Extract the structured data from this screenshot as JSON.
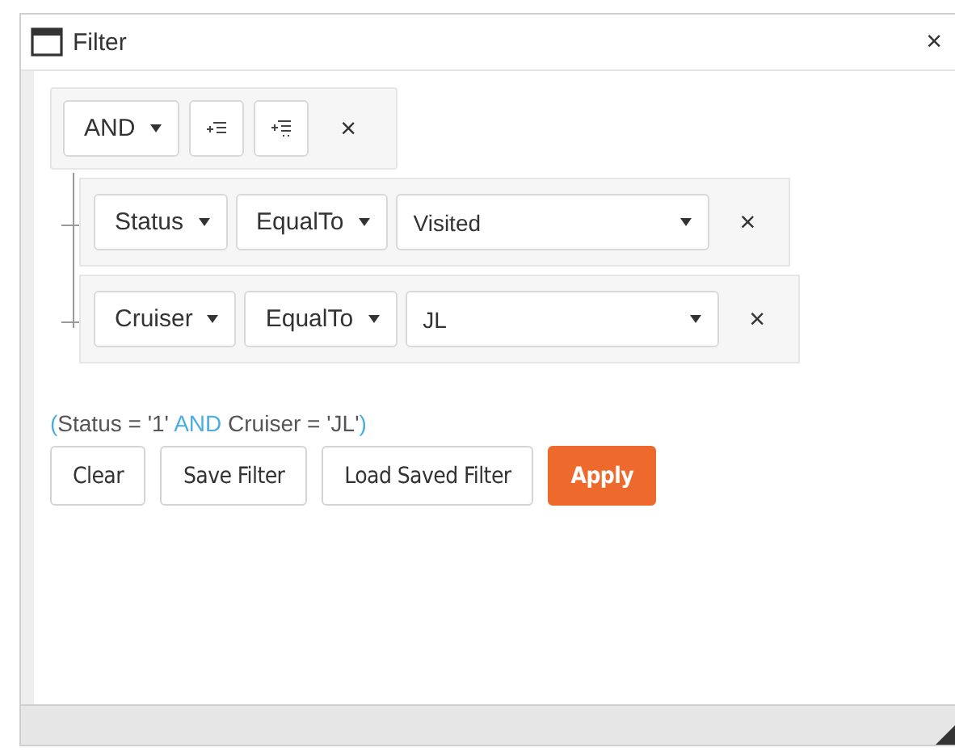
{
  "window": {
    "title": "Filter",
    "close": "×"
  },
  "group": {
    "operator": "AND",
    "remove": "×"
  },
  "rules": [
    {
      "field": "Status",
      "condition": "EqualTo",
      "value": "Visited",
      "remove": "×"
    },
    {
      "field": "Cruiser",
      "condition": "EqualTo",
      "value": "JL",
      "remove": "×"
    }
  ],
  "expression": [
    {
      "kind": "paren",
      "text": "("
    },
    {
      "kind": "text",
      "text": "Status = '1'"
    },
    {
      "kind": "operator",
      "text": "AND"
    },
    {
      "kind": "text",
      "text": "Cruiser = 'JL'"
    },
    {
      "kind": "paren",
      "text": ")"
    }
  ],
  "buttons": [
    {
      "label": "Clear",
      "kind": "default"
    },
    {
      "label": "Save Filter",
      "kind": "default"
    },
    {
      "label": "Load Saved Filter",
      "kind": "default"
    },
    {
      "label": "Apply",
      "kind": "primary"
    }
  ]
}
